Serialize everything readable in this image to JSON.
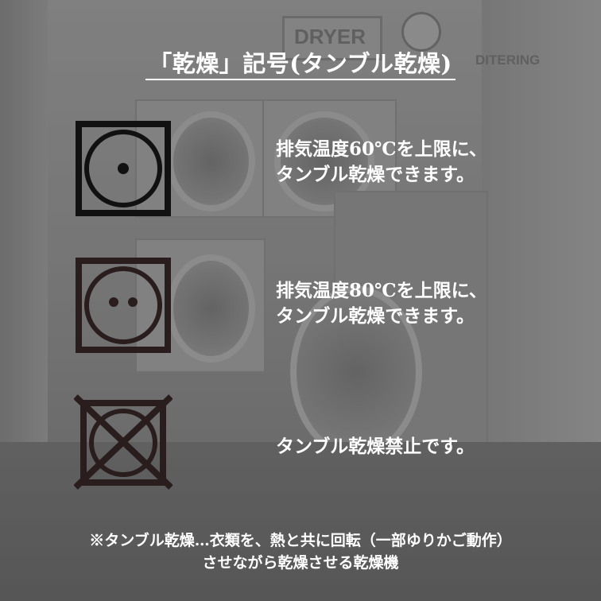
{
  "title": "「乾燥」記号(タンブル乾燥)",
  "symbols": [
    {
      "line1": "排気温度60℃を上限に、",
      "line2": "タンブル乾燥できます。",
      "dots": 1,
      "color": "#111111"
    },
    {
      "line1": "排気温度80℃を上限に、",
      "line2": "タンブル乾燥できます。",
      "dots": 2,
      "color": "#2a1d1d"
    },
    {
      "line1": "タンブル乾燥禁止です。",
      "dots": 0,
      "color": "#2a1d1d"
    }
  ],
  "note": {
    "line1": "※タンブル乾燥…衣類を、熱と共に回転（一部ゆりかご動作）",
    "line2": "させながら乾燥させる乾燥機"
  },
  "background_sign": "DRYER",
  "background_sign2": "DITERING"
}
